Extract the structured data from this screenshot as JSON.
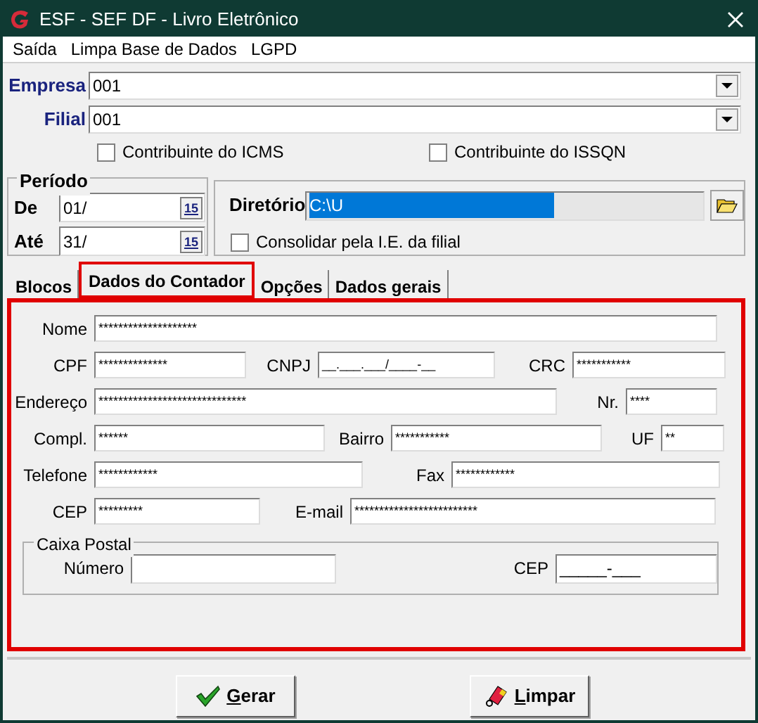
{
  "window": {
    "title": "ESF - SEF DF - Livro Eletrônico"
  },
  "menu": [
    {
      "label": "Saída"
    },
    {
      "label": "Limpa Base de Dados"
    },
    {
      "label": "LGPD"
    }
  ],
  "empresa": {
    "label": "Empresa",
    "value": "001"
  },
  "filial": {
    "label": "Filial",
    "value": "001"
  },
  "checkboxes": [
    {
      "label": "Contribuinte do ICMS",
      "checked": false
    },
    {
      "label": "Contribuinte do ISSQN",
      "checked": false
    }
  ],
  "periodo": {
    "title": "Período",
    "de": {
      "label": "De",
      "value": "01/",
      "picker_label": "15"
    },
    "ate": {
      "label": "Até",
      "value": "31/",
      "picker_label": "15"
    }
  },
  "diretorio": {
    "label": "Diretório",
    "value": "C:\\U",
    "text_selected": true,
    "consolidar": {
      "label": "Consolidar pela I.E. da filial",
      "checked": false
    }
  },
  "tabs": [
    {
      "label": "Blocos",
      "selected": false
    },
    {
      "label": "Dados do Contador",
      "selected": true
    },
    {
      "label": "Opções",
      "selected": false
    },
    {
      "label": "Dados gerais",
      "selected": false
    }
  ],
  "rows": [
    [
      {
        "label": "Nome",
        "value": "********************"
      }
    ],
    [
      {
        "label": "CPF",
        "value": "**************"
      },
      {
        "label": "CNPJ",
        "value": "__.___.___/____-__"
      },
      {
        "label": "CRC",
        "value": "***********"
      }
    ],
    [
      {
        "label": "Endereço",
        "value": "******************************"
      },
      {
        "label": "Nr.",
        "value": "****"
      }
    ],
    [
      {
        "label": "Compl.",
        "value": "******"
      },
      {
        "label": "Bairro",
        "value": "***********"
      },
      {
        "label": "UF",
        "value": "**"
      }
    ],
    [
      {
        "label": "Telefone",
        "value": "************"
      },
      {
        "label": "Fax",
        "value": "************"
      }
    ],
    [
      {
        "label": "CEP",
        "value": "*********"
      },
      {
        "label": "E-mail",
        "value": "*************************"
      }
    ]
  ],
  "caixa_postal": {
    "title": "Caixa Postal",
    "fields": [
      {
        "label": "Número"
      },
      {
        "label": "CEP",
        "value": "_____-___"
      }
    ]
  },
  "buttons": [
    {
      "label": "Gerar",
      "kind": "confirm",
      "mnemonic_underlined": true
    },
    {
      "label": "Limpar",
      "kind": "clear",
      "mnemonic_underlined": true
    }
  ]
}
